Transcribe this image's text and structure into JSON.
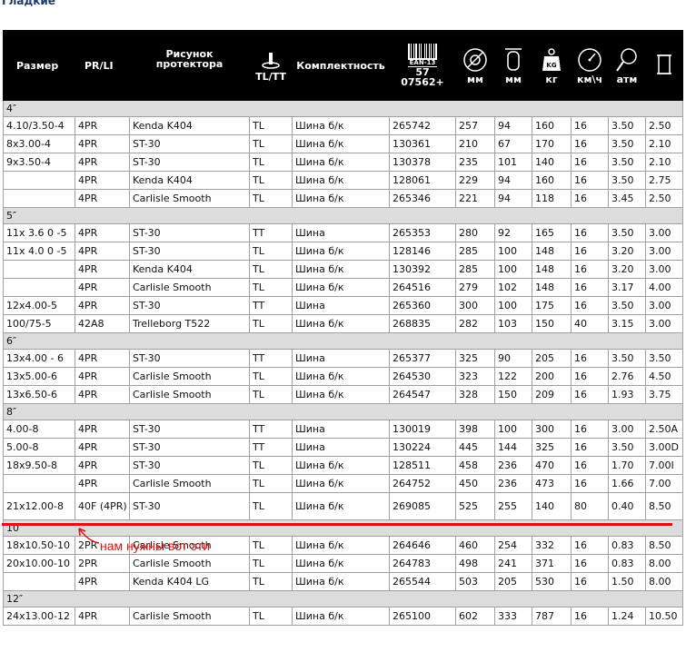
{
  "page": {
    "title": "Гладкие"
  },
  "header": {
    "size": "Размер",
    "prli": "PR/LI",
    "pattern": "Рисунок протектора",
    "tltt": "TL/TT",
    "set": "Комплектность",
    "ean_badge": "EAN-13",
    "ean_line1": "57",
    "ean_line2": "07562+",
    "u_mm1": "мм",
    "u_mm2": "мм",
    "u_kg": "кг",
    "u_kmh": "км\\ч",
    "u_atm": "атм",
    "icons": [
      "valve-icon",
      "barcode-icon",
      "tire-diameter-icon",
      "tire-width-icon",
      "weight-icon",
      "speedometer-icon",
      "pressure-gauge-icon",
      "rim-icon"
    ]
  },
  "sections": [
    {
      "label": "4″",
      "rows": [
        [
          "4.10/3.50-4",
          "4PR",
          "Kenda K404",
          "TL",
          "Шина б/к",
          "265742",
          "257",
          "94",
          "160",
          "16",
          "3.50",
          "2.50"
        ],
        [
          "8x3.00-4",
          "4PR",
          "ST-30",
          "TL",
          "Шина б/к",
          "130361",
          "210",
          "67",
          "170",
          "16",
          "3.50",
          "2.10"
        ],
        [
          "9x3.50-4",
          "4PR",
          "ST-30",
          "TL",
          "Шина б/к",
          "130378",
          "235",
          "101",
          "140",
          "16",
          "3.50",
          "2.10"
        ],
        [
          "",
          "4PR",
          "Kenda K404",
          "TL",
          "Шина б/к",
          "128061",
          "229",
          "94",
          "160",
          "16",
          "3.50",
          "2.75"
        ],
        [
          "",
          "4PR",
          "Carlisle Smooth",
          "TL",
          "Шина б/к",
          "265346",
          "221",
          "94",
          "118",
          "16",
          "3.45",
          "2.50"
        ]
      ]
    },
    {
      "label": "5″",
      "rows": [
        [
          "11x 3.6 0 -5",
          "4PR",
          "ST-30",
          "TT",
          "Шина",
          "265353",
          "280",
          "92",
          "165",
          "16",
          "3.50",
          "3.00"
        ],
        [
          "11x 4.0 0 -5",
          "4PR",
          "ST-30",
          "TL",
          "Шина б/к",
          "128146",
          "285",
          "100",
          "148",
          "16",
          "3.20",
          "3.00"
        ],
        [
          "",
          "4PR",
          "Kenda K404",
          "TL",
          "Шина б/к",
          "130392",
          "285",
          "100",
          "148",
          "16",
          "3.20",
          "3.00"
        ],
        [
          "",
          "4PR",
          "Carlisle Smooth",
          "TL",
          "Шина б/к",
          "264516",
          "279",
          "102",
          "148",
          "16",
          "3.17",
          "4.00"
        ],
        [
          "12x4.00-5",
          "4PR",
          "ST-30",
          "TT",
          "Шина",
          "265360",
          "300",
          "100",
          "175",
          "16",
          "3.50",
          "3.00"
        ],
        [
          "100/75-5",
          "42A8",
          "Trelleborg T522",
          "TL",
          "Шина б/к",
          "268835",
          "282",
          "103",
          "150",
          "40",
          "3.15",
          "3.00"
        ]
      ]
    },
    {
      "label": "6″",
      "rows": [
        [
          "13x4.00 - 6",
          "4PR",
          "ST-30",
          "TT",
          "Шина",
          "265377",
          "325",
          "90",
          "205",
          "16",
          "3.50",
          "3.50"
        ],
        [
          "13x5.00-6",
          "4PR",
          "Carlisle Smooth",
          "TL",
          "Шина б/к",
          "264530",
          "323",
          "122",
          "200",
          "16",
          "2.76",
          "4.50"
        ],
        [
          "13x6.50-6",
          "4PR",
          "Carlisle Smooth",
          "TL",
          "Шина б/к",
          "264547",
          "328",
          "150",
          "209",
          "16",
          "1.93",
          "3.75"
        ]
      ]
    },
    {
      "label": "8″",
      "rows": [
        [
          "4.00-8",
          "4PR",
          "ST-30",
          "TT",
          "Шина",
          "130019",
          "398",
          "100",
          "300",
          "16",
          "3.00",
          "2.50A"
        ],
        [
          "5.00-8",
          "4PR",
          "ST-30",
          "TT",
          "Шина",
          "130224",
          "445",
          "144",
          "325",
          "16",
          "3.50",
          "3.00D"
        ],
        [
          "18x9.50-8",
          "4PR",
          "ST-30",
          "TL",
          "Шина б/к",
          "128511",
          "458",
          "236",
          "470",
          "16",
          "1.70",
          "7.00I"
        ],
        [
          "",
          "4PR",
          "Carlisle Smooth",
          "TL",
          "Шина б/к",
          "264752",
          "450",
          "236",
          "473",
          "16",
          "1.66",
          "7.00"
        ],
        [
          "21x12.00-8",
          "40F (4PR)",
          "ST-30",
          "TL",
          "Шина б/к",
          "269085",
          "525",
          "255",
          "140",
          "80",
          "0.40",
          "8.50"
        ]
      ]
    },
    {
      "label": "10″",
      "rows": [
        [
          "18x10.50-10",
          "2PR",
          "Carlisle Smooth",
          "TL",
          "Шина б/к",
          "264646",
          "460",
          "254",
          "332",
          "16",
          "0.83",
          "8.50"
        ],
        [
          "20x10.00-10",
          "2PR",
          "Carlisle Smooth",
          "TL",
          "Шина б/к",
          "264783",
          "498",
          "241",
          "371",
          "16",
          "0.83",
          "8.00"
        ],
        [
          "",
          "4PR",
          "Kenda K404 LG",
          "TL",
          "Шина б/к",
          "265544",
          "503",
          "205",
          "530",
          "16",
          "1.50",
          "8.00"
        ]
      ]
    },
    {
      "label": "12″",
      "rows": [
        [
          "24x13.00-12",
          "4PR",
          "Carlisle Smooth",
          "TL",
          "Шина б/к",
          "265100",
          "602",
          "333",
          "787",
          "16",
          "1.24",
          "10.50"
        ]
      ]
    }
  ],
  "annotation": {
    "text": "нам нужны вот эти",
    "color": "#e01010"
  }
}
